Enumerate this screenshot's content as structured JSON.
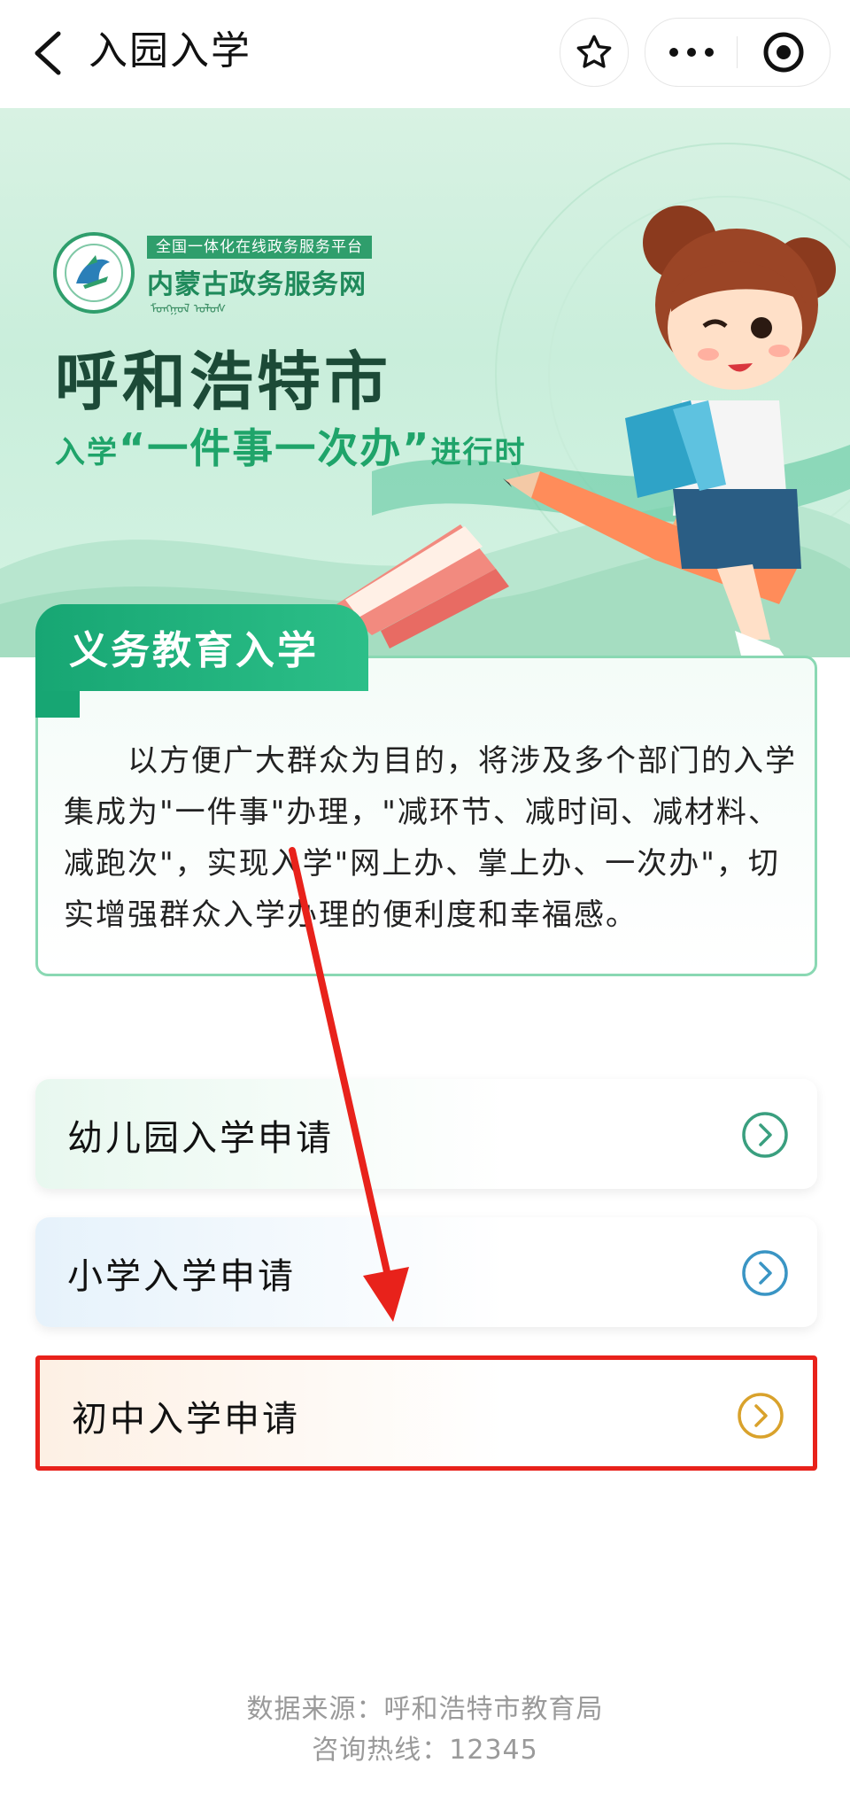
{
  "navbar": {
    "title": "入园入学",
    "icons": {
      "back": "chevron-left-icon",
      "favorite": "star-icon",
      "more": "more-dots-icon",
      "close": "target-circle-icon"
    }
  },
  "banner": {
    "platform_tag": "全国一体化在线政务服务平台",
    "platform_name": "内蒙古政务服务网",
    "mongol_script": "ᠮᠣᠩᠭᠣᠯ ᠤᠯᠤᠰ",
    "city": "呼和浩特市",
    "slogan_prefix": "入学",
    "slogan_highlight": "“一件事一次办”",
    "slogan_suffix": "进行时"
  },
  "intro": {
    "title": "义务教育入学",
    "body": "以方便广大群众为目的，将涉及多个部门的入学集成为\"一件事\"办理，\"减环节、减时间、减材料、减跑次\"，实现入学\"网上办、掌上办、一次办\"，切实增强群众入学办理的便利度和幸福感。"
  },
  "menu": {
    "items": [
      {
        "label": "幼儿园入学申请",
        "arrow_color": "#3a9f7f"
      },
      {
        "label": "小学入学申请",
        "arrow_color": "#3a95c4"
      },
      {
        "label": "初中入学申请",
        "arrow_color": "#d9a22c"
      }
    ],
    "highlight_color": "#e8221b"
  },
  "footer": {
    "source": "数据来源：呼和浩特市教育局",
    "hotline": "咨询热线：12345"
  }
}
